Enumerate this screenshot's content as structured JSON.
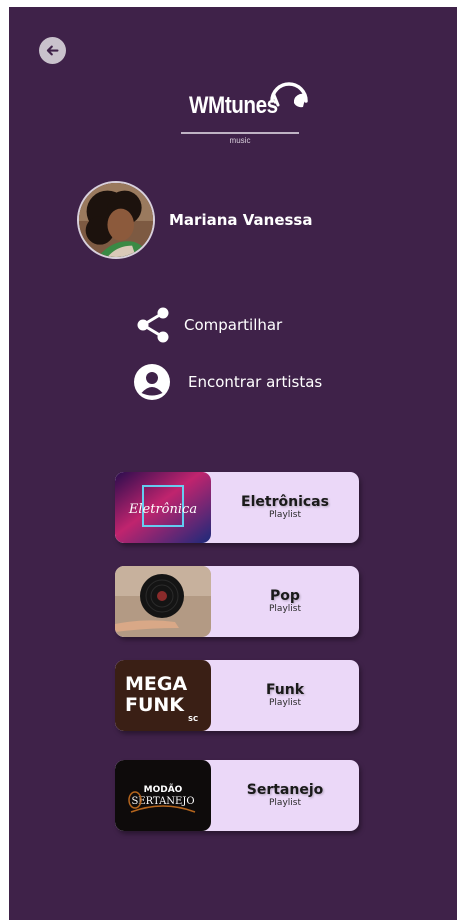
{
  "app": {
    "logo_text": "WMtunes",
    "logo_subtext": "music"
  },
  "profile": {
    "name": "Mariana Vanessa"
  },
  "actions": [
    {
      "label": "Compartilhar",
      "icon": "share-icon"
    },
    {
      "label": "Encontrar artistas",
      "icon": "user-circle-icon"
    }
  ],
  "playlists": [
    {
      "name": "Eletrônicas",
      "type": "Playlist",
      "cover_text": "Eletrônica"
    },
    {
      "name": "Pop",
      "type": "Playlist"
    },
    {
      "name": "Funk",
      "type": "Playlist",
      "cover_text": "MEGA FUNK"
    },
    {
      "name": "Sertanejo",
      "type": "Playlist",
      "cover_text": "MODÃO SERTANEJO"
    }
  ],
  "colors": {
    "background": "#3f2249",
    "card": "#ebd8f8",
    "back_button": "#c9c2cc"
  }
}
